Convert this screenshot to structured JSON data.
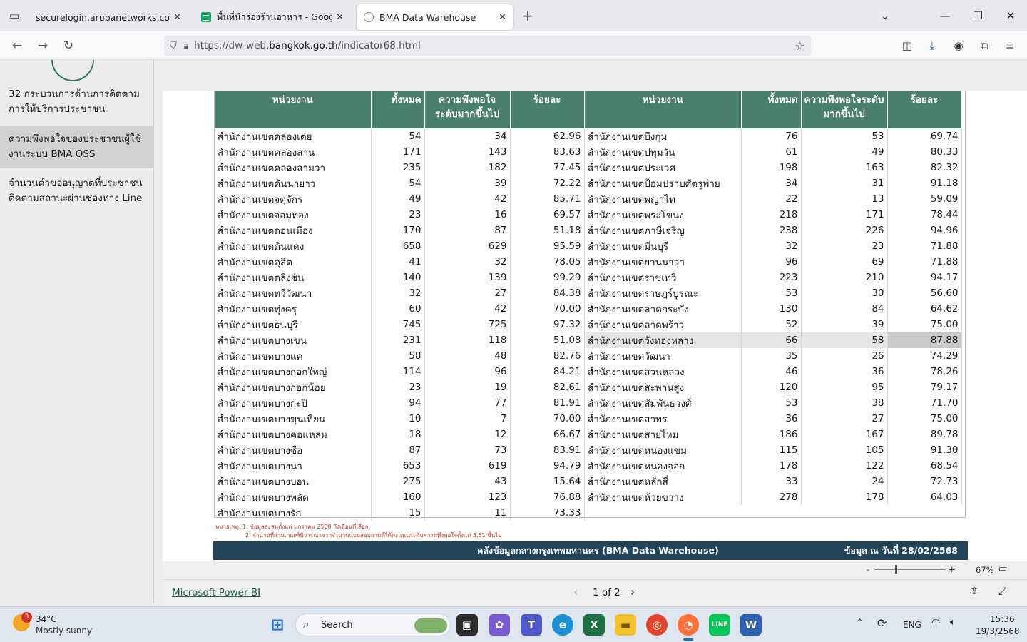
{
  "browser": {
    "tabs": [
      {
        "title": "securelogin.arubanetworks.com/cgi"
      },
      {
        "title": "พื้นที่นำร่องร้านอาหาร - Google ชี"
      },
      {
        "title": "BMA Data Warehouse"
      }
    ],
    "url_prefix": "https://dw-web.",
    "url_domain": "bangkok.go.th",
    "url_path": "/indicator68.html"
  },
  "sidebar": {
    "items": [
      {
        "label": "32 กระบวนการด้านการติดตามการให้บริการประชาชน"
      },
      {
        "label": "ความพึงพอใจของประชาชนผู้ใช้งานระบบ BMA OSS"
      },
      {
        "label": "จำนวนคำขออนุญาตที่ประชาชนติดตามสถานะผ่านช่องทาง Line"
      }
    ]
  },
  "table": {
    "headers": {
      "unit": "หน่วยงาน",
      "total": "ทั้งหมด",
      "satisfied": "ความพึงพอใจระดับมากขึ้นไป",
      "percent": "ร้อยละ"
    },
    "left_rows": [
      [
        "สำนักงานเขตคลองเตย",
        "54",
        "34",
        "62.96"
      ],
      [
        "สำนักงานเขตคลองสาน",
        "171",
        "143",
        "83.63"
      ],
      [
        "สำนักงานเขตคลองสามวา",
        "235",
        "182",
        "77.45"
      ],
      [
        "สำนักงานเขตคันนายาว",
        "54",
        "39",
        "72.22"
      ],
      [
        "สำนักงานเขตจตุจักร",
        "49",
        "42",
        "85.71"
      ],
      [
        "สำนักงานเขตจอมทอง",
        "23",
        "16",
        "69.57"
      ],
      [
        "สำนักงานเขตดอนเมือง",
        "170",
        "87",
        "51.18"
      ],
      [
        "สำนักงานเขตดินแดง",
        "658",
        "629",
        "95.59"
      ],
      [
        "สำนักงานเขตดุสิต",
        "41",
        "32",
        "78.05"
      ],
      [
        "สำนักงานเขตตลิ่งชัน",
        "140",
        "139",
        "99.29"
      ],
      [
        "สำนักงานเขตทวีวัฒนา",
        "32",
        "27",
        "84.38"
      ],
      [
        "สำนักงานเขตทุ่งครุ",
        "60",
        "42",
        "70.00"
      ],
      [
        "สำนักงานเขตธนบุรี",
        "745",
        "725",
        "97.32"
      ],
      [
        "สำนักงานเขตบางเขน",
        "231",
        "118",
        "51.08"
      ],
      [
        "สำนักงานเขตบางแค",
        "58",
        "48",
        "82.76"
      ],
      [
        "สำนักงานเขตบางกอกใหญ่",
        "114",
        "96",
        "84.21"
      ],
      [
        "สำนักงานเขตบางกอกน้อย",
        "23",
        "19",
        "82.61"
      ],
      [
        "สำนักงานเขตบางกะปิ",
        "94",
        "77",
        "81.91"
      ],
      [
        "สำนักงานเขตบางขุนเทียน",
        "10",
        "7",
        "70.00"
      ],
      [
        "สำนักงานเขตบางคอแหลม",
        "18",
        "12",
        "66.67"
      ],
      [
        "สำนักงานเขตบางซื่อ",
        "87",
        "73",
        "83.91"
      ],
      [
        "สำนักงานเขตบางนา",
        "653",
        "619",
        "94.79"
      ],
      [
        "สำนักงานเขตบางบอน",
        "275",
        "43",
        "15.64"
      ],
      [
        "สำนักงานเขตบางพลัด",
        "160",
        "123",
        "76.88"
      ],
      [
        "สำนักงานเขตบางรัก",
        "15",
        "11",
        "73.33"
      ]
    ],
    "right_rows": [
      [
        "สำนักงานเขตบึงกุ่ม",
        "76",
        "53",
        "69.74"
      ],
      [
        "สำนักงานเขตปทุมวัน",
        "61",
        "49",
        "80.33"
      ],
      [
        "สำนักงานเขตประเวศ",
        "198",
        "163",
        "82.32"
      ],
      [
        "สำนักงานเขตป้อมปราบศัตรูพ่าย",
        "34",
        "31",
        "91.18"
      ],
      [
        "สำนักงานเขตพญาไท",
        "22",
        "13",
        "59.09"
      ],
      [
        "สำนักงานเขตพระโขนง",
        "218",
        "171",
        "78.44"
      ],
      [
        "สำนักงานเขตภาษีเจริญ",
        "238",
        "226",
        "94.96"
      ],
      [
        "สำนักงานเขตมีนบุรี",
        "32",
        "23",
        "71.88"
      ],
      [
        "สำนักงานเขตยานนาวา",
        "96",
        "69",
        "71.88"
      ],
      [
        "สำนักงานเขตราชเทวี",
        "223",
        "210",
        "94.17"
      ],
      [
        "สำนักงานเขตราษฎร์บูรณะ",
        "53",
        "30",
        "56.60"
      ],
      [
        "สำนักงานเขตลาดกระบัง",
        "130",
        "84",
        "64.62"
      ],
      [
        "สำนักงานเขตลาดพร้าว",
        "52",
        "39",
        "75.00"
      ],
      [
        "สำนักงานเขตวังทองหลาง",
        "66",
        "58",
        "87.88"
      ],
      [
        "สำนักงานเขตวัฒนา",
        "35",
        "26",
        "74.29"
      ],
      [
        "สำนักงานเขตสวนหลวง",
        "46",
        "36",
        "78.26"
      ],
      [
        "สำนักงานเขตสะพานสูง",
        "120",
        "95",
        "79.17"
      ],
      [
        "สำนักงานเขตสัมพันธวงศ์",
        "53",
        "38",
        "71.70"
      ],
      [
        "สำนักงานเขตสาทร",
        "36",
        "27",
        "75.00"
      ],
      [
        "สำนักงานเขตสายไหม",
        "186",
        "167",
        "89.78"
      ],
      [
        "สำนักงานเขตหนองแขม",
        "115",
        "105",
        "91.30"
      ],
      [
        "สำนักงานเขตหนองจอก",
        "178",
        "122",
        "68.54"
      ],
      [
        "สำนักงานเขตหลักสี่",
        "33",
        "24",
        "72.73"
      ],
      [
        "สำนักงานเขตห้วยขวาง",
        "278",
        "178",
        "64.03"
      ]
    ]
  },
  "notes": {
    "line1": "หมายเหตุ: 1. ข้อมูลสะสมตั้งแต่ มกราคม 2568 ถึงเดือนที่เลือก",
    "line2": "2. จำนวนที่ผ่านเกณฑ์พิจารณาจากจำนวนแบบสอบถามที่ได้คะแนนระดับความพึงพอใจตั้งแต่ 3.51 ขึ้นไป"
  },
  "footer": {
    "title": "คลังข้อมูลกลางกรุงเทพมหานคร (BMA Data Warehouse)",
    "date": "ข้อมูล ณ วันที่ 28/02/2568"
  },
  "zoom": {
    "minus": "-",
    "plus": "+",
    "level": "67%"
  },
  "powerbi": {
    "link": "Microsoft Power BI",
    "page": "1 of 2"
  },
  "taskbar": {
    "weather_temp": "34°C",
    "weather_desc": "Mostly sunny",
    "weather_badge": "3",
    "search_label": "Search",
    "lang": "ENG",
    "time": "15:36",
    "date": "19/3/2568"
  }
}
